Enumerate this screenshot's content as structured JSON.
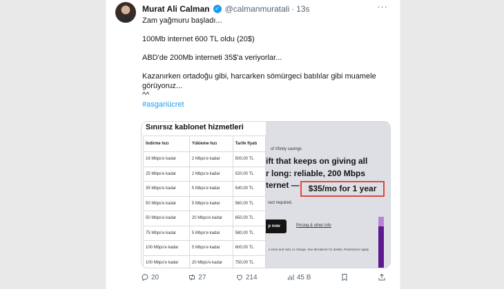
{
  "tweet": {
    "author_name": "Murat Ali Calman",
    "handle": "@calmanmuratali",
    "dot": "·",
    "time": "13s",
    "more": "···",
    "text": "Zam yağmuru başladı...\n\n100Mb internet 600 TL oldu (20$)\n\nABD'de 200Mb interneti 35$'a veriyorlar...\n\nKazanırken ortadoğu gibi, harcarken sömürgeci batılılar gibi muamele\ngörüyoruz...\n^^",
    "hashtag": "#asgariücret"
  },
  "media": {
    "left": {
      "title": "Sınırsız kablonet hizmetleri",
      "columns": [
        "İndirme hızı",
        "Yükleme hızı",
        "Tarife fiyatı"
      ],
      "rows": [
        [
          "16 Mbps'e kadar",
          "2 Mbps'e kadar",
          "500,00 TL"
        ],
        [
          "25 Mbps'e kadar",
          "2 Mbps'e kadar",
          "520,00 TL"
        ],
        [
          "35 Mbps'e kadar",
          "5 Mbps'e kadar",
          "540,00 TL"
        ],
        [
          "50 Mbps'e kadar",
          "5 Mbps'e kadar",
          "560,00 TL"
        ],
        [
          "50 Mbps'e kadar",
          "20 Mbps'e kadar",
          "650,00 TL"
        ],
        [
          "75 Mbps'e kadar",
          "5 Mbps'e kadar",
          "580,00 TL"
        ],
        [
          "100 Mbps'e kadar",
          "5 Mbps'e kadar",
          "600,00 TL"
        ],
        [
          "100 Mbps'e kadar",
          "20 Mbps'e kadar",
          "750,00 TL"
        ]
      ]
    },
    "right": {
      "small": "of Xfinity savings",
      "line1": "ift that keeps on giving all",
      "line2": "r long: reliable, 200 Mbps",
      "line3": "ternet —",
      "highlight": "$35/mo for 1 year",
      "note": "ract required.",
      "button": "p now",
      "link": "Pricing & other info",
      "footer": "s extra and subj. to change. See disclaimer for details. Restrictions apply."
    }
  },
  "actions": {
    "replies": "20",
    "retweets": "27",
    "likes": "214",
    "views": "45 B"
  },
  "colors": {
    "accent": "#1d9bf0",
    "highlight_border": "#e0483a"
  }
}
